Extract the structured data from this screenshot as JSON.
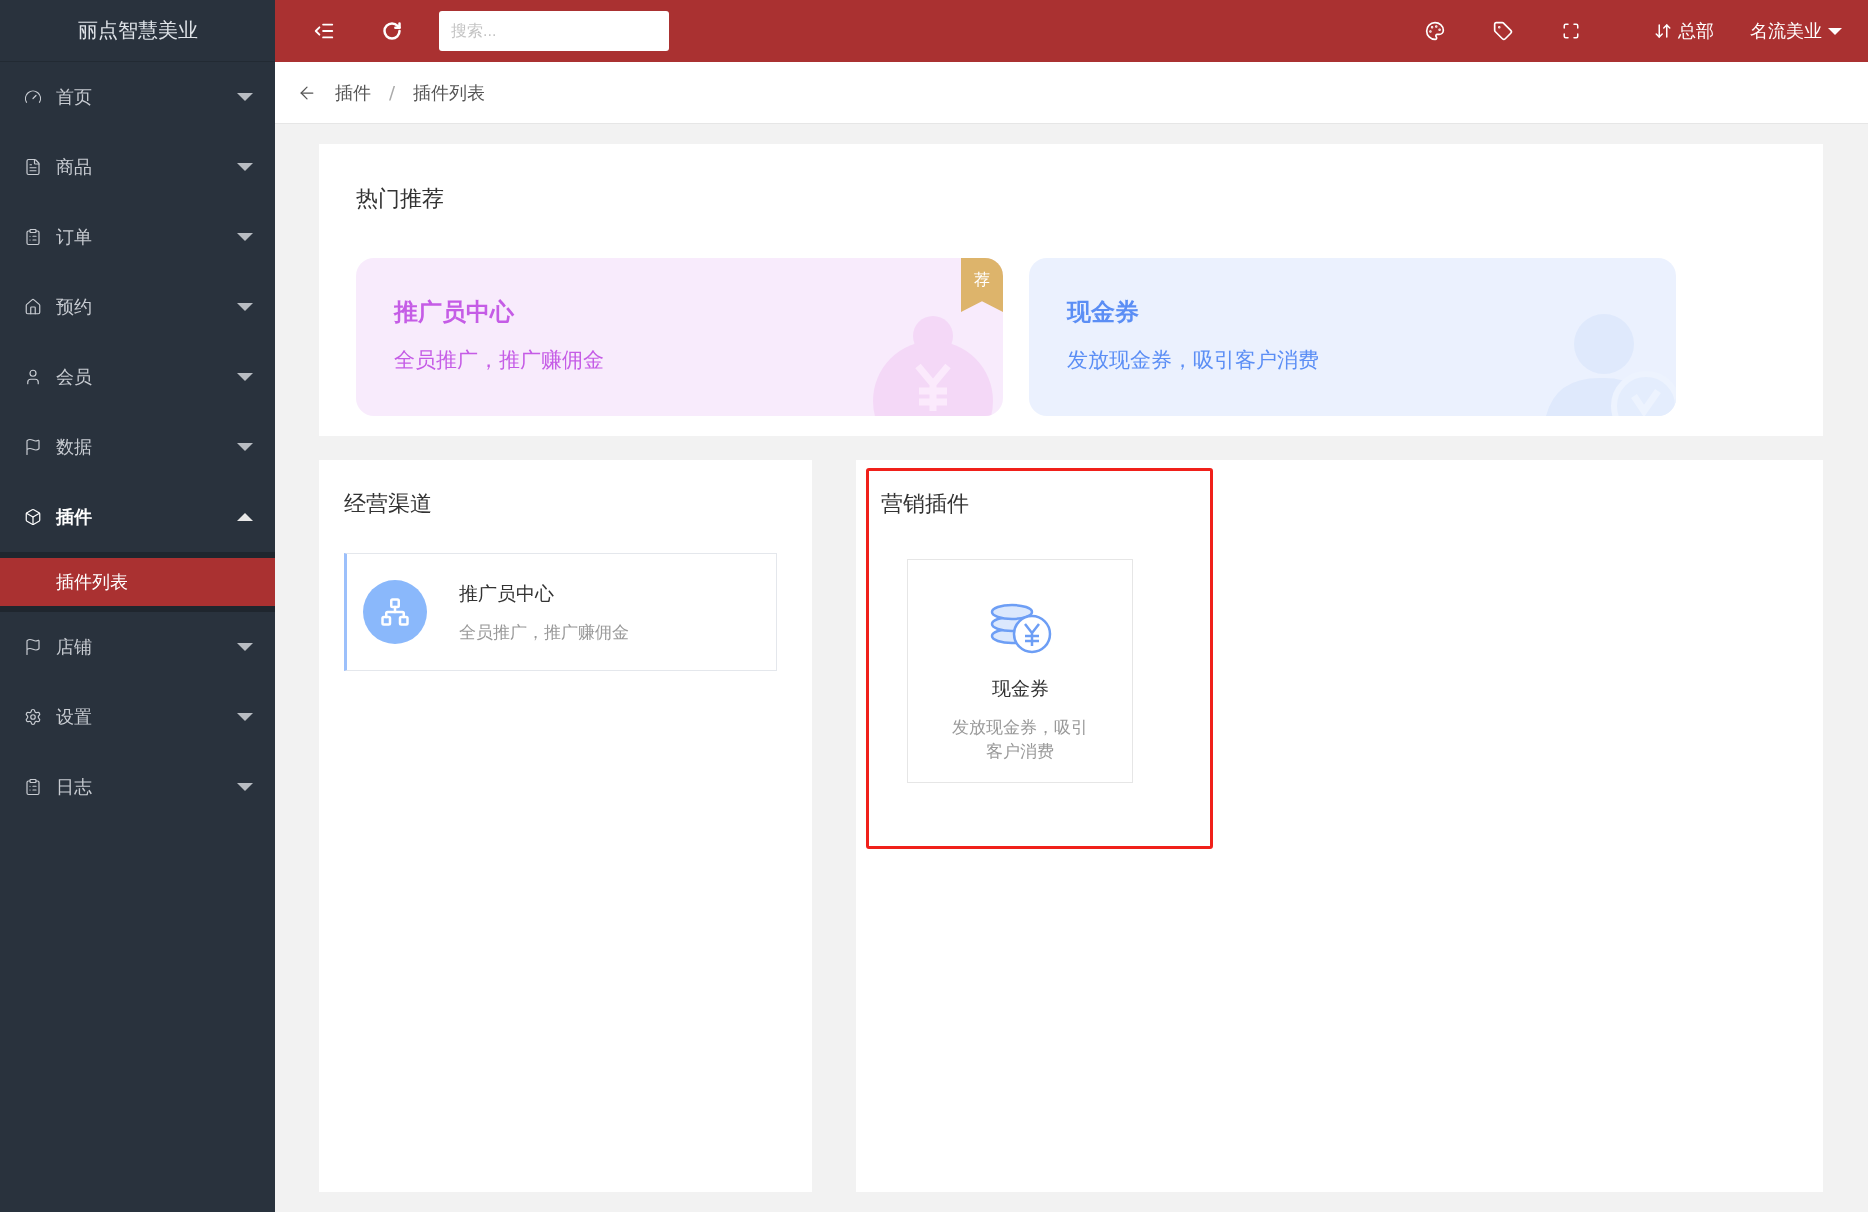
{
  "brand": "丽点智慧美业",
  "sidebar": {
    "items": [
      {
        "label": "首页",
        "expanded": false
      },
      {
        "label": "商品",
        "expanded": false
      },
      {
        "label": "订单",
        "expanded": false
      },
      {
        "label": "预约",
        "expanded": false
      },
      {
        "label": "会员",
        "expanded": false
      },
      {
        "label": "数据",
        "expanded": false
      },
      {
        "label": "插件",
        "expanded": true,
        "children": [
          {
            "label": "插件列表",
            "selected": true
          }
        ]
      },
      {
        "label": "店铺",
        "expanded": false
      },
      {
        "label": "设置",
        "expanded": false
      },
      {
        "label": "日志",
        "expanded": false
      }
    ]
  },
  "topbar": {
    "search": {
      "placeholder": "搜索..."
    },
    "store": "总部",
    "user": "名流美业"
  },
  "breadcrumb": {
    "items": [
      "插件",
      "插件列表"
    ],
    "separator": "/"
  },
  "hot": {
    "title": "热门推荐",
    "cards": [
      {
        "title": "推广员中心",
        "desc": "全员推广，推广赚佣金",
        "color": "#c55ce6",
        "kind": "moneybag",
        "badge": "荐"
      },
      {
        "title": "现金券",
        "desc": "发放现金券，吸引客户消费",
        "color": "#5b8ef5",
        "kind": "person"
      }
    ]
  },
  "sections": [
    {
      "title": "经营渠道",
      "kind": "list",
      "highlighted": false,
      "items": [
        {
          "title": "推广员中心",
          "desc": "全员推广，推广赚佣金"
        }
      ]
    },
    {
      "title": "营销插件",
      "kind": "tile",
      "highlighted": true,
      "items": [
        {
          "title": "现金券",
          "desc": "发放现金券，吸引客户消费"
        }
      ]
    }
  ]
}
